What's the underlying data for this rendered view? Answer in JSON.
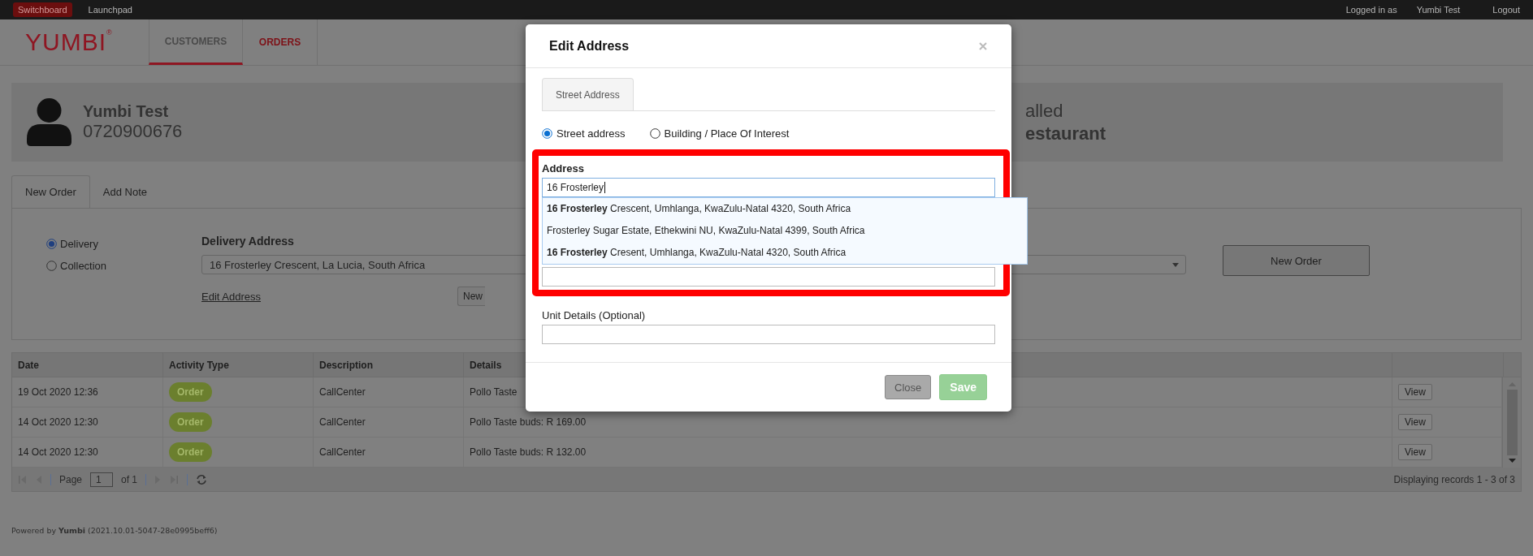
{
  "top_bar": {
    "links": [
      {
        "label": "Switchboard",
        "selected": true
      },
      {
        "label": "Launchpad",
        "selected": false
      }
    ],
    "logged_in_label": "Logged in as",
    "user": "Yumbi Test",
    "logout": "Logout"
  },
  "header": {
    "logo": "YUMBI$^{®}$",
    "nav": [
      {
        "label": "CUSTOMERS",
        "selected": true
      },
      {
        "label": "ORDERS",
        "selected": false
      }
    ]
  },
  "customer": {
    "name": "Yumbi Test",
    "phone": "0720900676",
    "status_fragment": "alled",
    "restaurant_fragment": "estaurant"
  },
  "order_tabs": [
    {
      "label": "New Order",
      "selected": true
    },
    {
      "label": "Add Note",
      "selected": false
    }
  ],
  "order_type": [
    {
      "label": "Delivery",
      "selected": true
    },
    {
      "label": "Collection",
      "selected": false
    }
  ],
  "delivery_address": {
    "label": "Delivery Address",
    "value": "16 Frosterley Crescent, La Lucia, South Africa",
    "edit_link": "Edit Address",
    "button_fragment": "New"
  },
  "new_order_button": "New Order",
  "table": {
    "columns": [
      "Date",
      "Activity Type",
      "Description",
      "Details"
    ],
    "rows": [
      {
        "date": "19 Oct 2020 12:36",
        "activity": "Order",
        "description": "CallCenter",
        "details": "Pollo Taste",
        "action": "View"
      },
      {
        "date": "14 Oct 2020 12:30",
        "activity": "Order",
        "description": "CallCenter",
        "details": "Pollo Taste buds: R 169.00",
        "action": "View"
      },
      {
        "date": "14 Oct 2020 12:30",
        "activity": "Order",
        "description": "CallCenter",
        "details": "Pollo Taste buds: R 132.00",
        "action": "View"
      }
    ]
  },
  "pager": {
    "page_label": "Page",
    "page": "1",
    "of": "of 1",
    "summary": "Displaying records 1 - 3 of 3"
  },
  "footer": "Powered by **Yumbi** (2021.10.01-5047-28e0995beff6)",
  "modal": {
    "title": "Edit Address",
    "tabs": [
      {
        "label": "Street Address",
        "selected": true
      }
    ],
    "address_types": [
      {
        "label": "Street address",
        "selected": true
      },
      {
        "label": "Building / Place Of Interest",
        "selected": false
      }
    ],
    "address_label": "Address",
    "address_value": "16 Frosterley",
    "suggestions": [
      "**16 Frosterley** Crescent, Umhlanga, KwaZulu-Natal 4320, South Africa",
      "Frosterley Sugar Estate, Ethekwini NU, KwaZulu-Natal 4399, South Africa",
      "**16 Frosterley** Cresent, Umhlanga, KwaZulu-Natal 4320, South Africa"
    ],
    "unit_label": "Unit Details (Optional)",
    "buttons": [
      {
        "label": "Close",
        "kind": "secondary",
        "disabled": false
      },
      {
        "label": "Save",
        "kind": "primary",
        "disabled": true
      }
    ]
  }
}
